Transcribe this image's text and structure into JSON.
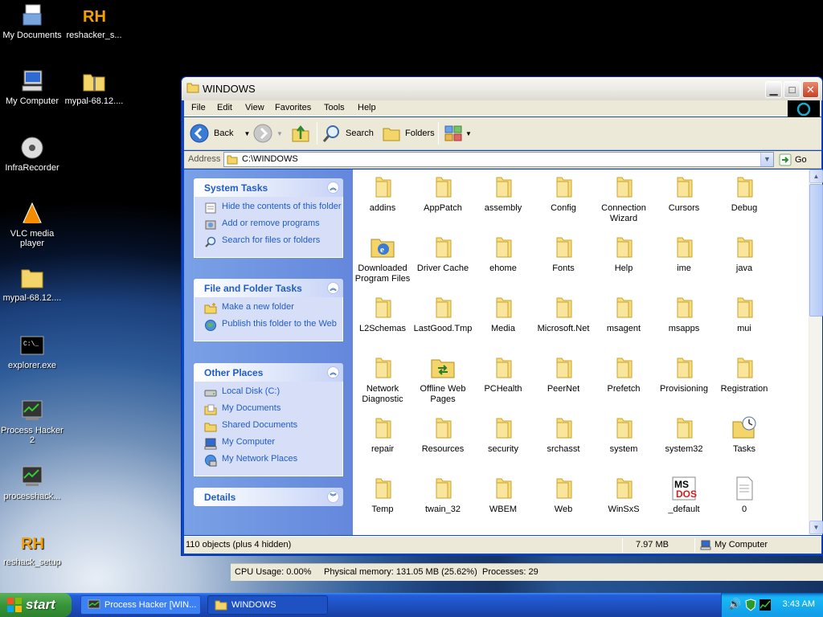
{
  "desktop": {
    "icons": [
      {
        "label": "My Documents",
        "icon": "my-documents-icon"
      },
      {
        "label": "reshacker_s...",
        "icon": "reshacker-icon"
      },
      {
        "label": "My Computer",
        "icon": "my-computer-icon"
      },
      {
        "label": "mypal-68.12....",
        "icon": "zip-folder-icon"
      },
      {
        "label": "InfraRecorder",
        "icon": "infrarecorder-icon"
      },
      {
        "label": "VLC media player",
        "icon": "vlc-icon"
      },
      {
        "label": "mypal-68.12....",
        "icon": "folder-icon"
      },
      {
        "label": "explorer.exe",
        "icon": "console-icon"
      },
      {
        "label": "Process Hacker 2",
        "icon": "process-hacker-icon"
      },
      {
        "label": "processhack...",
        "icon": "process-hacker-icon"
      },
      {
        "label": "reshack_setup",
        "icon": "reshacker-icon"
      }
    ]
  },
  "window": {
    "title": "WINDOWS",
    "menu": [
      "File",
      "Edit",
      "View",
      "Favorites",
      "Tools",
      "Help"
    ],
    "toolbar": {
      "back": "Back",
      "search": "Search",
      "folders": "Folders"
    },
    "address": {
      "label": "Address",
      "value": "C:\\WINDOWS",
      "go": "Go"
    },
    "panels": {
      "system_tasks": {
        "title": "System Tasks",
        "items": [
          "Hide the contents of this folder",
          "Add or remove programs",
          "Search for files or folders"
        ]
      },
      "file_folder_tasks": {
        "title": "File and Folder Tasks",
        "items": [
          "Make a new folder",
          "Publish this folder to the Web"
        ]
      },
      "other_places": {
        "title": "Other Places",
        "items": [
          "Local Disk (C:)",
          "My Documents",
          "Shared Documents",
          "My Computer",
          "My Network Places"
        ]
      },
      "details": {
        "title": "Details"
      }
    },
    "files": [
      {
        "name": "addins",
        "icon": "folder-icon"
      },
      {
        "name": "AppPatch",
        "icon": "folder-icon"
      },
      {
        "name": "assembly",
        "icon": "folder-icon"
      },
      {
        "name": "Config",
        "icon": "folder-icon"
      },
      {
        "name": "Connection Wizard",
        "icon": "folder-icon"
      },
      {
        "name": "Cursors",
        "icon": "folder-icon"
      },
      {
        "name": "Debug",
        "icon": "folder-icon"
      },
      {
        "name": "Downloaded Program Files",
        "icon": "ie-folder-icon"
      },
      {
        "name": "Driver Cache",
        "icon": "folder-icon"
      },
      {
        "name": "ehome",
        "icon": "folder-icon"
      },
      {
        "name": "Fonts",
        "icon": "folder-icon"
      },
      {
        "name": "Help",
        "icon": "folder-icon"
      },
      {
        "name": "ime",
        "icon": "folder-icon"
      },
      {
        "name": "java",
        "icon": "folder-icon"
      },
      {
        "name": "L2Schemas",
        "icon": "folder-icon"
      },
      {
        "name": "LastGood.Tmp",
        "icon": "folder-icon"
      },
      {
        "name": "Media",
        "icon": "folder-icon"
      },
      {
        "name": "Microsoft.Net",
        "icon": "folder-icon"
      },
      {
        "name": "msagent",
        "icon": "folder-icon"
      },
      {
        "name": "msapps",
        "icon": "folder-icon"
      },
      {
        "name": "mui",
        "icon": "folder-icon"
      },
      {
        "name": "Network Diagnostic",
        "icon": "folder-icon"
      },
      {
        "name": "Offline Web Pages",
        "icon": "sync-folder-icon"
      },
      {
        "name": "PCHealth",
        "icon": "folder-icon"
      },
      {
        "name": "PeerNet",
        "icon": "folder-icon"
      },
      {
        "name": "Prefetch",
        "icon": "folder-icon"
      },
      {
        "name": "Provisioning",
        "icon": "folder-icon"
      },
      {
        "name": "Registration",
        "icon": "folder-icon"
      },
      {
        "name": "repair",
        "icon": "folder-icon"
      },
      {
        "name": "Resources",
        "icon": "folder-icon"
      },
      {
        "name": "security",
        "icon": "folder-icon"
      },
      {
        "name": "srchasst",
        "icon": "folder-icon"
      },
      {
        "name": "system",
        "icon": "folder-icon"
      },
      {
        "name": "system32",
        "icon": "folder-icon"
      },
      {
        "name": "Tasks",
        "icon": "tasks-folder-icon"
      },
      {
        "name": "Temp",
        "icon": "folder-icon"
      },
      {
        "name": "twain_32",
        "icon": "folder-icon"
      },
      {
        "name": "WBEM",
        "icon": "folder-icon"
      },
      {
        "name": "Web",
        "icon": "folder-icon"
      },
      {
        "name": "WinSxS",
        "icon": "folder-icon"
      },
      {
        "name": "_default",
        "icon": "ms-dos-icon"
      },
      {
        "name": "0",
        "icon": "text-file-icon"
      }
    ],
    "status": {
      "objects": "110 objects (plus 4 hidden)",
      "size": "7.97 MB",
      "location": "My Computer"
    }
  },
  "process_hacker_status": {
    "cpu": "CPU Usage: 0.00%",
    "memory": "Physical memory: 131.05 MB (25.62%)",
    "processes": "Processes: 29"
  },
  "taskbar": {
    "start": "start",
    "tasks": [
      {
        "label": "Process Hacker [WIN...",
        "active": false
      },
      {
        "label": "WINDOWS",
        "active": true
      }
    ],
    "clock": "3:43 AM"
  }
}
